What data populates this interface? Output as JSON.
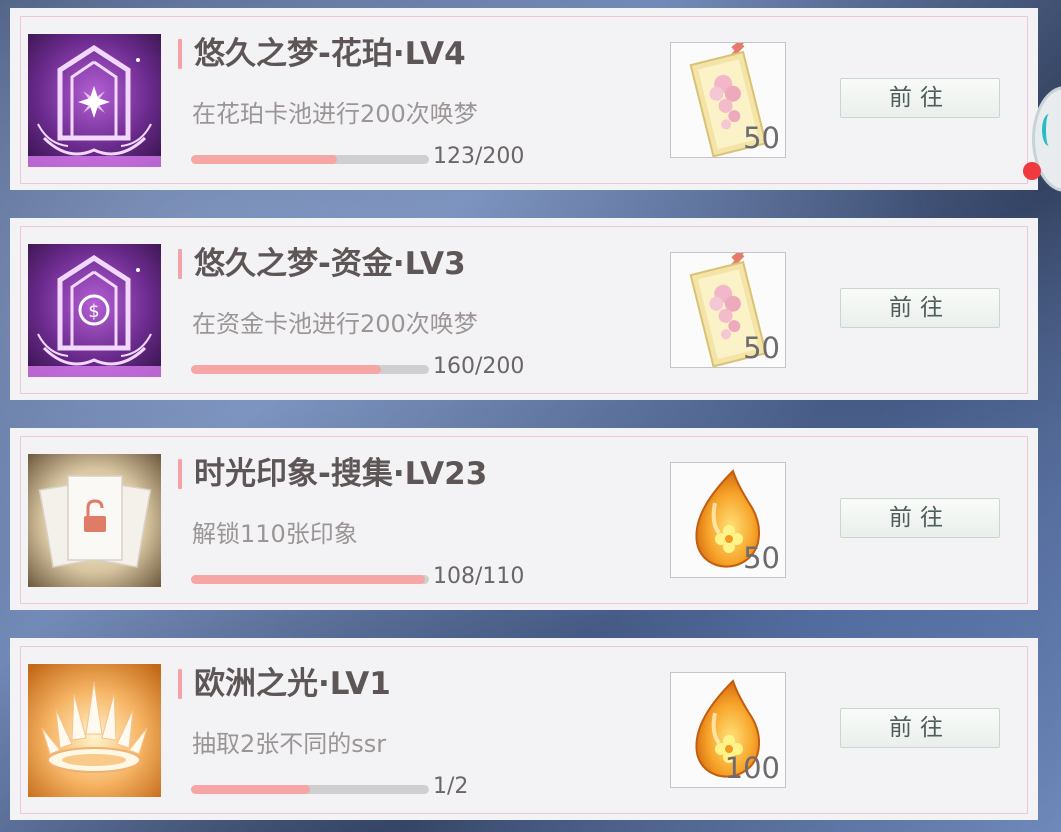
{
  "quests": [
    {
      "title": "悠久之梦-花珀·LV4",
      "desc": "在花珀卡池进行200次唤梦",
      "progress": 0.615,
      "progress_text": "123/200",
      "reward_qty": "50",
      "reward_icon": "ticket-icon",
      "badge_icon": "flower-emblem-icon",
      "button": "前往"
    },
    {
      "title": "悠久之梦-资金·LV3",
      "desc": "在资金卡池进行200次唤梦",
      "progress": 0.8,
      "progress_text": "160/200",
      "reward_qty": "50",
      "reward_icon": "ticket-icon",
      "badge_icon": "coin-emblem-icon",
      "button": "前往"
    },
    {
      "title": "时光印象-搜集·LV23",
      "desc": "解锁110张印象",
      "progress": 0.982,
      "progress_text": "108/110",
      "reward_qty": "50",
      "reward_icon": "amber-drop-icon",
      "badge_icon": "unlocked-cards-icon",
      "button": "前往"
    },
    {
      "title": "欧洲之光·LV1",
      "desc": "抽取2张不同的ssr",
      "progress": 0.5,
      "progress_text": "1/2",
      "reward_qty": "100",
      "reward_icon": "amber-drop-icon",
      "badge_icon": "crown-icon",
      "button": "前往"
    }
  ],
  "colors": {
    "progress_fill": "#f7a6a6",
    "title_accent": "#f4a2a8",
    "card_border": "#efc8d8"
  }
}
